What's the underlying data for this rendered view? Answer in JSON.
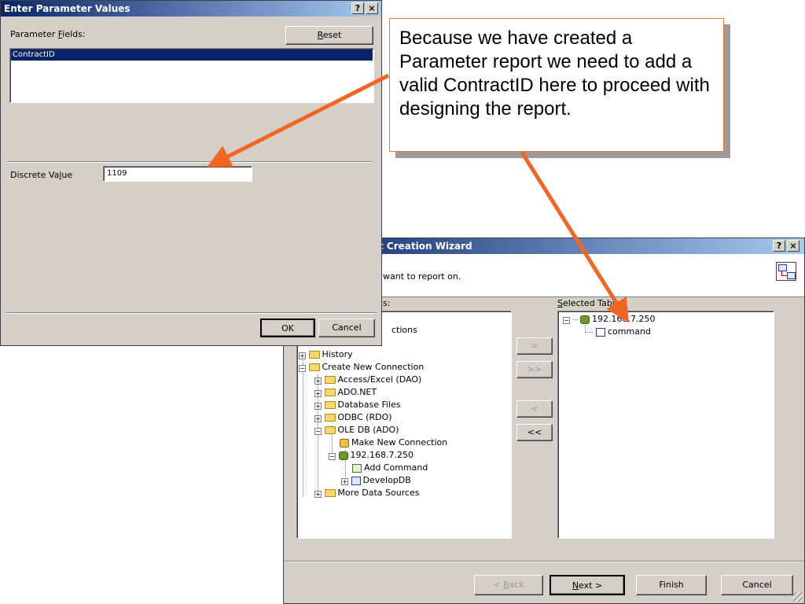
{
  "param_dialog": {
    "title": "Enter Parameter Values",
    "help_button": "?",
    "close_button": "×",
    "fields_label_pre": "Parameter ",
    "fields_label_accel": "F",
    "fields_label_post": "ields:",
    "reset_accel": "R",
    "reset_rest": "eset",
    "fields": [
      "ContractID"
    ],
    "discrete_label_pre": "Discrete Va",
    "discrete_label_accel": "l",
    "discrete_label_post": "ue",
    "discrete_value": "1109",
    "ok_label": "OK",
    "cancel_label": "Cancel"
  },
  "wizard": {
    "title_fragment": "t Creation Wizard",
    "help_button": "?",
    "close_button": "×",
    "instruction_fragment": "want to report on.",
    "available_label_fragment": "s:",
    "selected_label_accel": "S",
    "selected_label_rest": "elected Tables:",
    "available_tree": [
      {
        "label": "ctions"
      },
      {
        "label": "History"
      },
      {
        "label": "Create New Connection"
      },
      {
        "label": "Access/Excel (DAO)"
      },
      {
        "label": "ADO.NET"
      },
      {
        "label": "Database Files"
      },
      {
        "label": "ODBC (RDO)"
      },
      {
        "label": "OLE DB (ADO)"
      },
      {
        "label": "Make New Connection"
      },
      {
        "label": "192.168.7.250"
      },
      {
        "label": "Add Command"
      },
      {
        "label": "DevelopDB"
      },
      {
        "label": "More Data Sources"
      }
    ],
    "selected_tree": [
      {
        "label": "192.168.7.250"
      },
      {
        "label": "command"
      }
    ],
    "move_buttons": [
      ">",
      ">>",
      "<",
      "<<"
    ],
    "back_pre": "< ",
    "back_accel": "B",
    "back_rest": "ack",
    "next_accel": "N",
    "next_rest": "ext >",
    "finish_label": "Finish",
    "cancel_label": "Cancel"
  },
  "callout": {
    "text": "Because we have created a Parameter report we need to add a valid ContractID here to proceed with designing the report.",
    "arrow_color": "#f26522",
    "border_color": "#e87a2c"
  }
}
